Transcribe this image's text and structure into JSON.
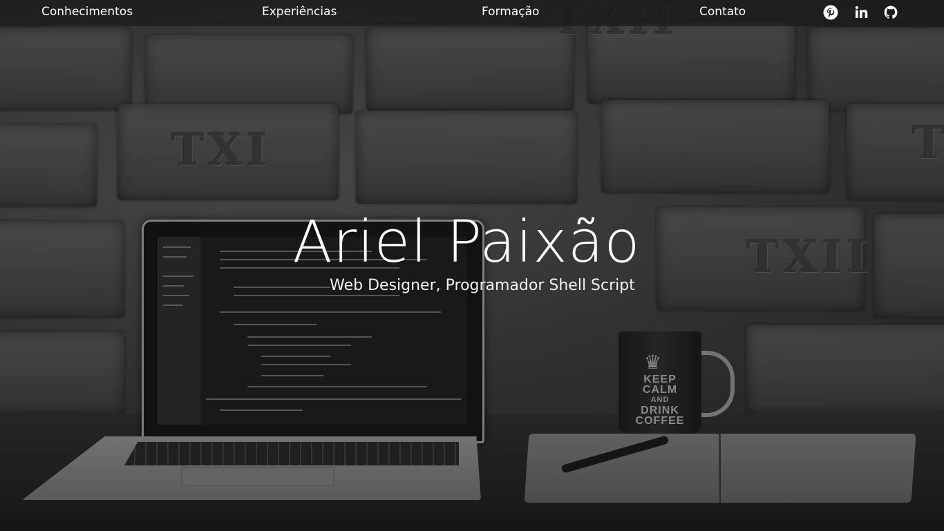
{
  "nav": {
    "items": [
      {
        "label": "Conhecimentos"
      },
      {
        "label": "Experiências"
      },
      {
        "label": "Formação"
      },
      {
        "label": "Contato"
      }
    ],
    "social": [
      {
        "icon": "pinterest-icon"
      },
      {
        "icon": "linkedin-icon"
      },
      {
        "icon": "github-icon"
      }
    ]
  },
  "hero": {
    "title": "Ariel Paixão",
    "subtitle": "Web Designer, Programador Shell Script"
  },
  "background": {
    "mug_text": {
      "line1": "KEEP",
      "line2": "CALM",
      "line3": "AND",
      "line4": "DRINK",
      "line5": "COFFEE"
    },
    "brick_marks": [
      "TXII",
      "TXI",
      "TXII",
      "T"
    ]
  },
  "colors": {
    "nav_bg": "#191919",
    "text": "#ffffff"
  }
}
